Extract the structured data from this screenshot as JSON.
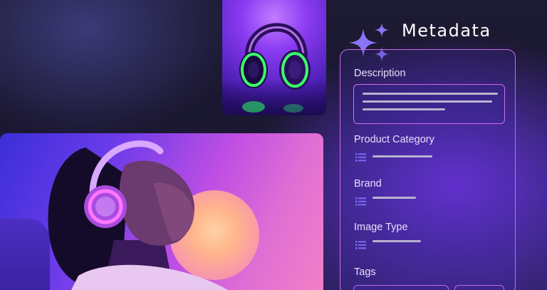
{
  "metadata_panel": {
    "title": "Metadata",
    "fields": {
      "description": "Description",
      "product_category": "Product Category",
      "brand": "Brand",
      "image_type": "Image Type",
      "tags": "Tags"
    }
  },
  "icons": {
    "sparkle": "sparkle-icon",
    "list": "list-icon"
  },
  "colors": {
    "accent_border": "#c86de8",
    "icon": "#7c6cf2",
    "placeholder_line": "#b9b3cf",
    "text": "#ffffff"
  }
}
